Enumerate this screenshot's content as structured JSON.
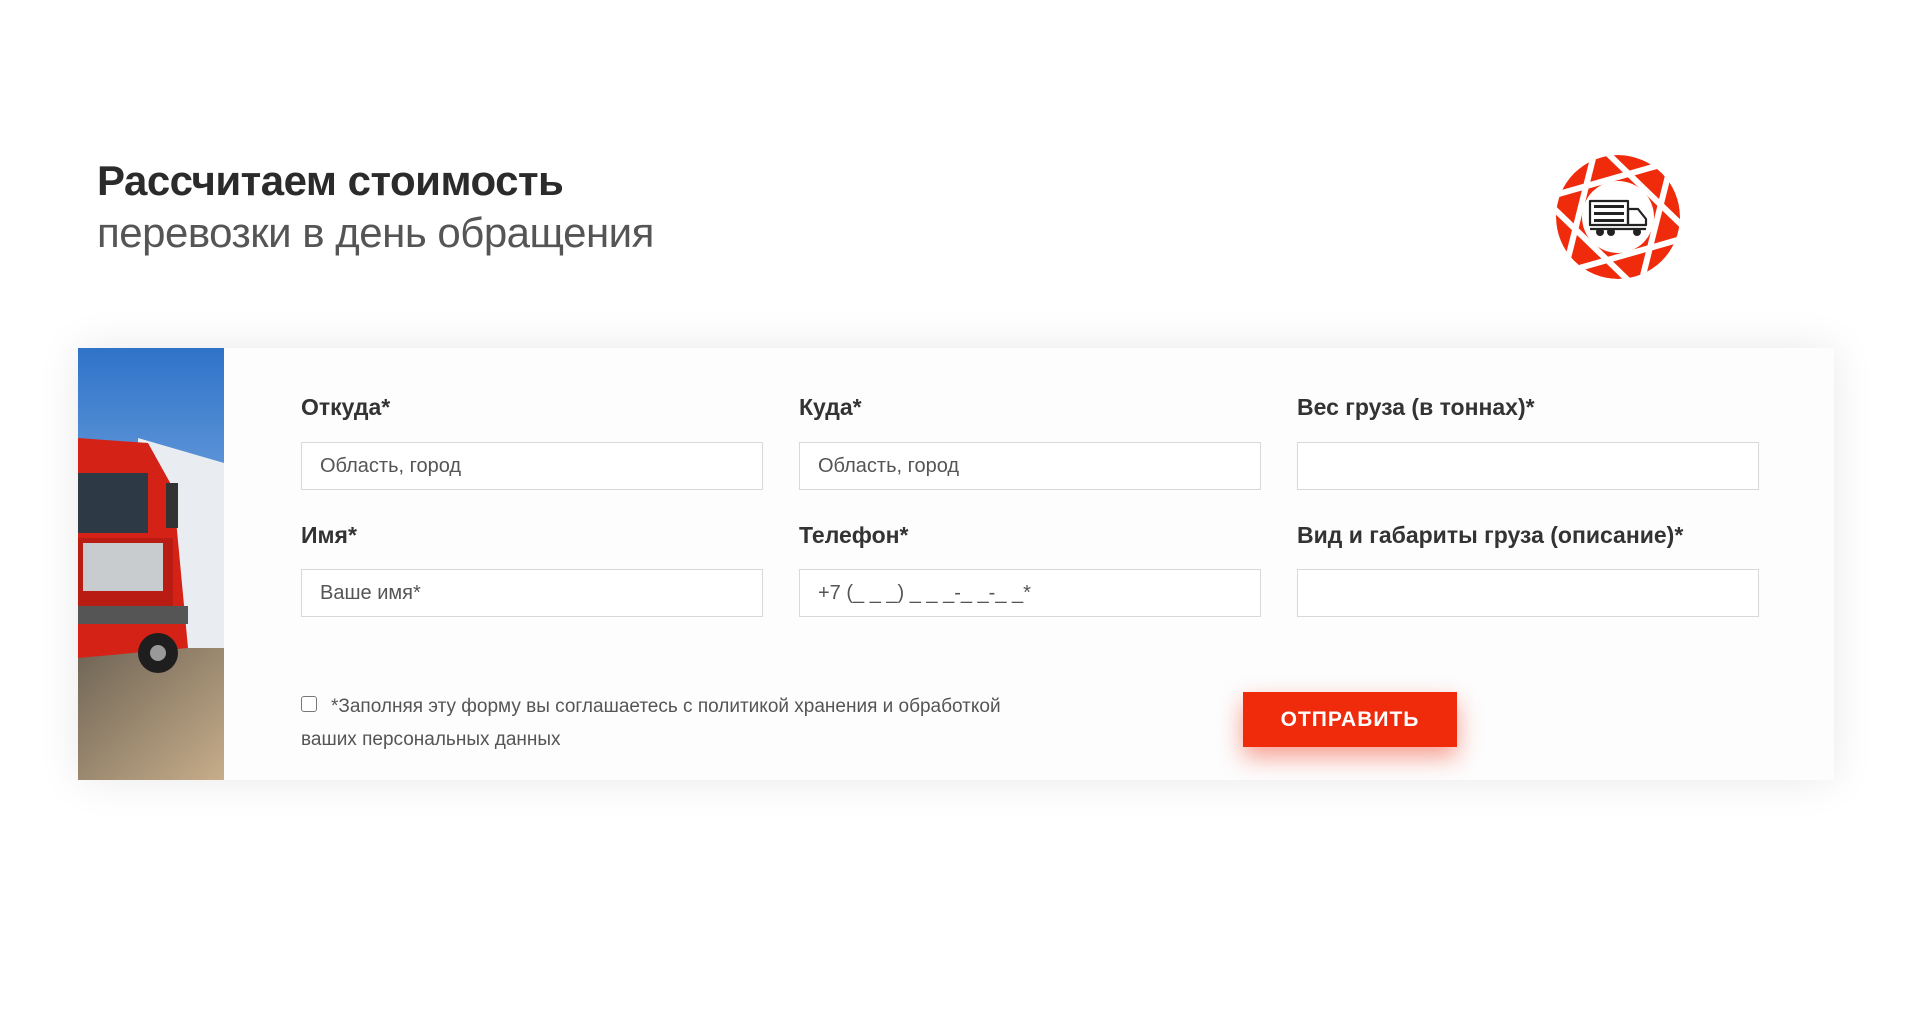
{
  "header": {
    "title_bold": "Рассчитаем стоимость",
    "title_light": "перевозки в день обращения"
  },
  "logo": {
    "icon": "truck-aperture-logo",
    "color": "#ef2b0c"
  },
  "form": {
    "from": {
      "label": "Откуда*",
      "placeholder": "Область, город"
    },
    "to": {
      "label": "Куда*",
      "placeholder": "Область, город"
    },
    "weight": {
      "label": "Вес груза (в тоннах)*",
      "placeholder": ""
    },
    "name": {
      "label": "Имя*",
      "placeholder": "Ваше имя*"
    },
    "phone": {
      "label": "Телефон*",
      "placeholder": "+7 (_ _ _) _ _ _-_ _-_ _*"
    },
    "cargo": {
      "label": "Вид и габариты груза (описание)*",
      "placeholder": ""
    },
    "consent_text": "*Заполняя эту форму вы соглашаетесь с политикой хранения и обработкой ваших персональных данных",
    "submit_label": "ОТПРАВИТЬ"
  },
  "colors": {
    "accent": "#ef2b0c",
    "text_dark": "#2b2b2b"
  }
}
